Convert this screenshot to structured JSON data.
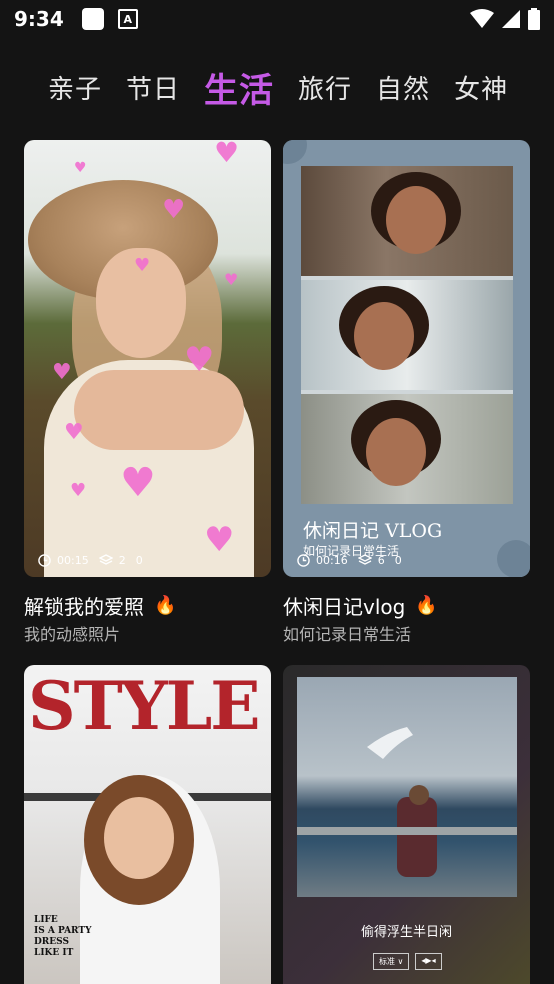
{
  "status_bar": {
    "time": "9:34",
    "a_badge": "A"
  },
  "tabs": [
    {
      "label": "亲子",
      "active": false
    },
    {
      "label": "节日",
      "active": false
    },
    {
      "label": "生活",
      "active": true
    },
    {
      "label": "旅行",
      "active": false
    },
    {
      "label": "自然",
      "active": false
    },
    {
      "label": "女神",
      "active": false
    }
  ],
  "cards": [
    {
      "title": "解锁我的爱照",
      "subtitle": "我的动感照片",
      "duration": "00:15",
      "layers": "2",
      "extra": "0",
      "hot": true
    },
    {
      "title": "休闲日记vlog",
      "subtitle": "如何记录日常生活",
      "duration": "00:16",
      "layers": "6",
      "extra": "0",
      "hot": true,
      "overlay_title": "休闲日记 VLOG",
      "overlay_sub": "如何记录日常生活"
    },
    {
      "overlay_title": "STYLE",
      "overlay_caption_1": "LIFE",
      "overlay_caption_2": "IS A PARTY",
      "overlay_caption_3": "DRESS",
      "overlay_caption_4": "LIKE IT"
    },
    {
      "overlay_text": "偷得浮生半日闲",
      "btn_1": "标准 ∨",
      "btn_2": "◂▶◂"
    }
  ],
  "colors": {
    "accent": "#c55ae6",
    "background": "#141414",
    "fire": "#f5911e"
  }
}
